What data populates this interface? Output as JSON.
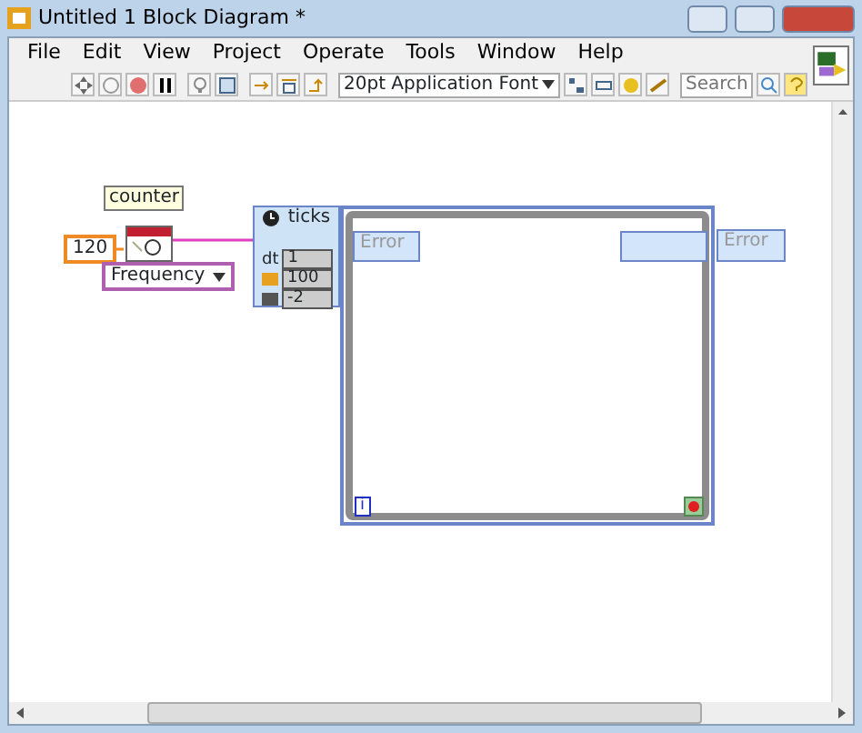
{
  "window": {
    "title": "Untitled 1 Block Diagram *"
  },
  "menu": [
    "File",
    "Edit",
    "View",
    "Project",
    "Operate",
    "Tools",
    "Window",
    "Help"
  ],
  "toolbar": {
    "font": "20pt Application Font",
    "search": {
      "placeholder": "Search"
    }
  },
  "diagram": {
    "label": "counter",
    "constant": "120",
    "enum": "Frequency",
    "timed_loop": {
      "title": "ticks",
      "inputs": [
        {
          "label": "dt",
          "value": "1"
        },
        {
          "value": "100"
        },
        {
          "value": "-2"
        }
      ],
      "left_node": "Error",
      "iteration": "i"
    },
    "output_node": "Error"
  }
}
